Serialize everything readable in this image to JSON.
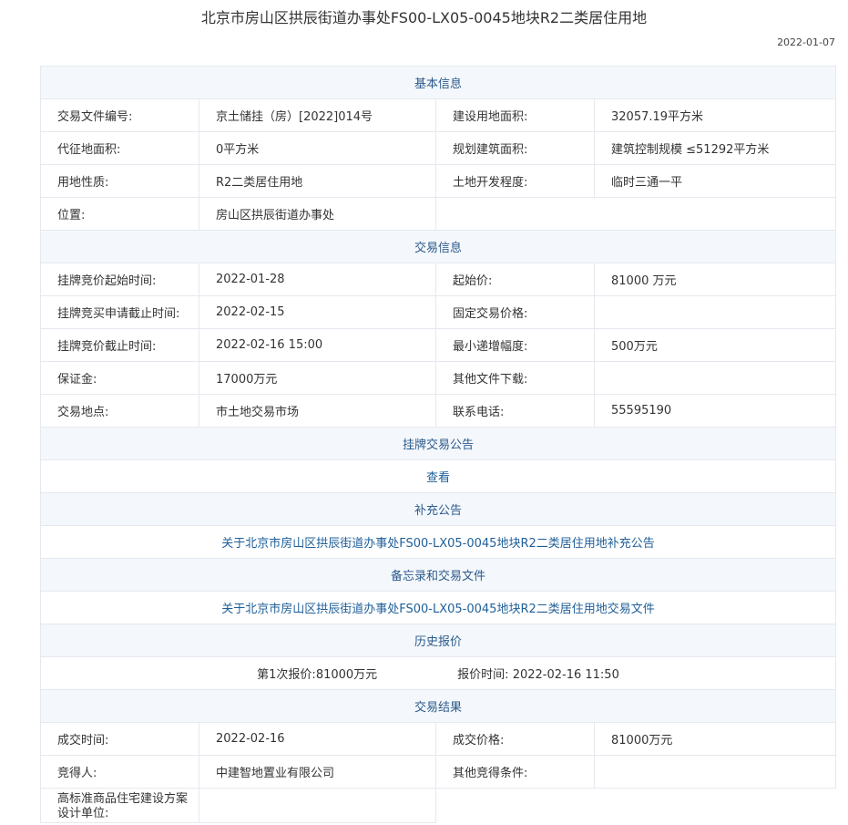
{
  "header": {
    "title": "北京市房山区拱辰街道办事处FS00-LX05-0045地块R2二类居住用地",
    "date": "2022-01-07"
  },
  "basic_info": {
    "section_title": "基本信息",
    "file_no_label": "交易文件编号:",
    "file_no": "京土储挂（房）[2022]014号",
    "land_area_label": "建设用地面积:",
    "land_area": "32057.19平方米",
    "acq_area_label": "代征地面积:",
    "acq_area": "0平方米",
    "build_area_label": "规划建筑面积:",
    "build_area": "建筑控制规模 ≤51292平方米",
    "land_use_label": "用地性质:",
    "land_use": "R2二类居住用地",
    "dev_level_label": "土地开发程度:",
    "dev_level": "临时三通一平",
    "location_label": "位置:",
    "location": "房山区拱辰街道办事处"
  },
  "trade_info": {
    "section_title": "交易信息",
    "start_time_label": "挂牌竞价起始时间:",
    "start_time": "2022-01-28",
    "start_price_label": "起始价:",
    "start_price": "81000 万元",
    "apply_deadline_label": "挂牌竞买申请截止时间:",
    "apply_deadline": "2022-02-15",
    "fixed_price_label": "固定交易价格:",
    "fixed_price": "",
    "bid_deadline_label": "挂牌竞价截止时间:",
    "bid_deadline": "2022-02-16 15:00",
    "min_increment_label": "最小递增幅度:",
    "min_increment": "500万元",
    "deposit_label": "保证金:",
    "deposit": "17000万元",
    "other_files_label": "其他文件下载:",
    "other_files": "",
    "place_label": "交易地点:",
    "place": "市土地交易市场",
    "phone_label": "联系电话:",
    "phone": "55595190"
  },
  "listing_notice": {
    "section_title": "挂牌交易公告",
    "link": "查看"
  },
  "supplement": {
    "section_title": "补充公告",
    "link": "关于北京市房山区拱辰街道办事处FS00-LX05-0045地块R2二类居住用地补充公告"
  },
  "memo": {
    "section_title": "备忘录和交易文件",
    "link": "关于北京市房山区拱辰街道办事处FS00-LX05-0045地块R2二类居住用地交易文件"
  },
  "history": {
    "section_title": "历史报价",
    "bid_label": "第1次报价:",
    "bid_value": "81000万元",
    "time_label": "报价时间:",
    "time_value": "2022-02-16 11:50"
  },
  "result": {
    "section_title": "交易结果",
    "deal_time_label": "成交时间:",
    "deal_time": "2022-02-16",
    "deal_price_label": "成交价格:",
    "deal_price": "81000万元",
    "winner_label": "竞得人:",
    "winner": "中建智地置业有限公司",
    "other_cond_label": "其他竞得条件:",
    "other_cond": "",
    "design_unit_label": "高标准商品住宅建设方案设计单位:",
    "design_unit": ""
  }
}
